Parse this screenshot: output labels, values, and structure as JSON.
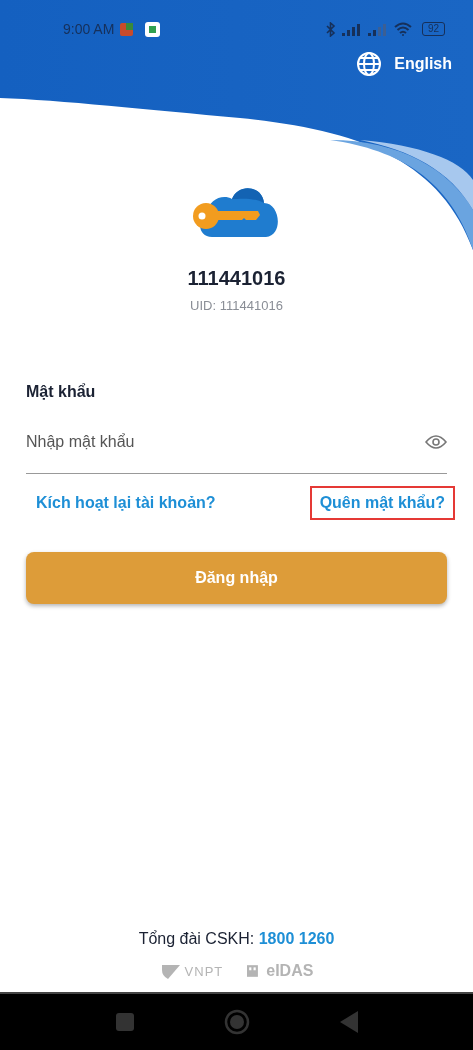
{
  "status_bar": {
    "time": "9:00 AM",
    "battery": "92"
  },
  "language": {
    "label": "English"
  },
  "account": {
    "number": "111441016",
    "uid": "UID: 111441016"
  },
  "password": {
    "label": "Mật khẩu",
    "placeholder": "Nhập mật khẩu"
  },
  "links": [
    {
      "label": "Kích hoạt lại tài khoản?",
      "highlighted": false
    },
    {
      "label": "Quên mật khẩu?",
      "highlighted": true
    }
  ],
  "login_button": {
    "label": "Đăng nhập"
  },
  "hotline": {
    "label": "Tổng đài CSKH:",
    "number": "1800 1260"
  },
  "partners": [
    "VNPT",
    "eIDAS"
  ]
}
